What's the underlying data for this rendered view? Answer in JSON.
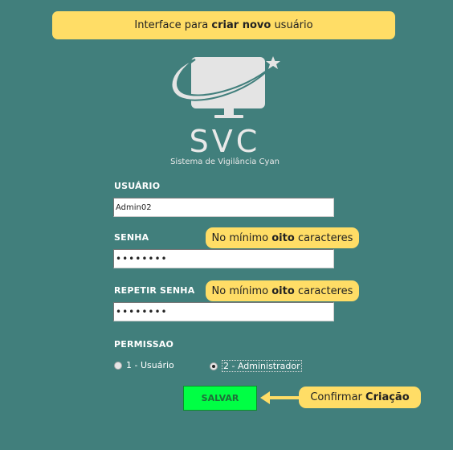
{
  "banner": {
    "prefix": "Interface para ",
    "bold": "criar novo",
    "suffix": " usuário"
  },
  "logo": {
    "brand": "SVC",
    "subtitle": "Sistema de Vigilância Cyan"
  },
  "form": {
    "usuario_label": "USUÁRIO",
    "usuario_value": "Admin02",
    "senha_label": "SENHA",
    "senha_value": "••••••••",
    "repetir_label": "REPETIR SENHA",
    "repetir_value": "••••••••",
    "permissao_label": "PERMISSAO",
    "options": [
      {
        "label": "1 - Usuário",
        "selected": false
      },
      {
        "label": "2 - Administrador",
        "selected": true
      }
    ],
    "save_label": "SALVAR"
  },
  "tips": {
    "min_prefix": "No mínimo ",
    "min_bold": "oito",
    "min_suffix": " caracteres",
    "confirm_prefix": "Confirmar ",
    "confirm_bold": "Criação"
  },
  "colors": {
    "background": "#417f7c",
    "callout": "#ffdd66",
    "save_button": "#00ff44"
  }
}
